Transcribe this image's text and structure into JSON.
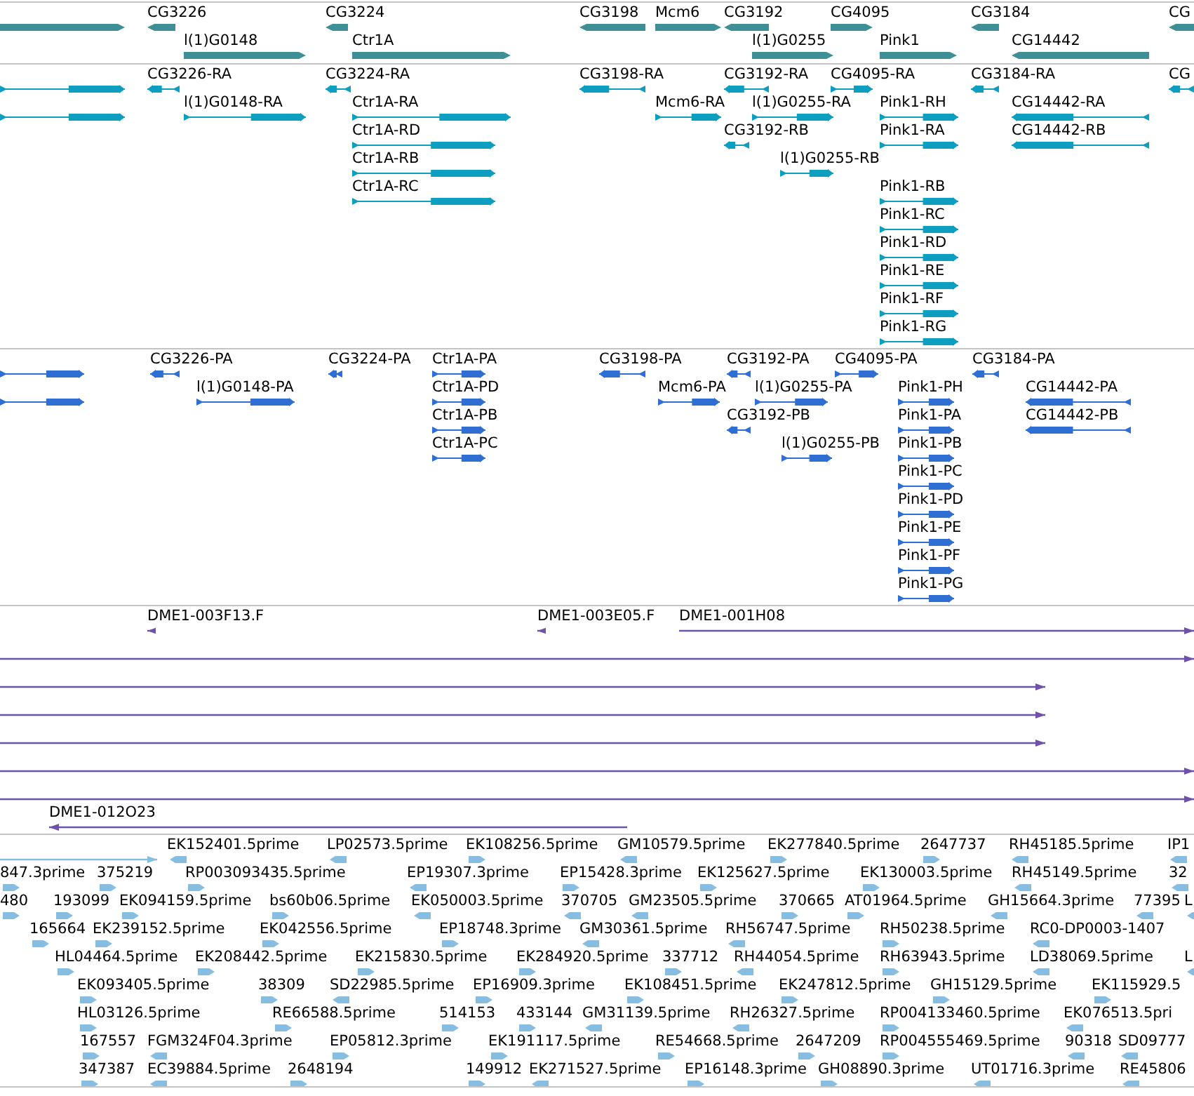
{
  "tracks": [
    {
      "kind": "gene",
      "features": [
        {
          "reverse": false
        },
        {
          "label": "CG3226",
          "reverse": true
        },
        {
          "label": "CG3224",
          "reverse": true
        },
        {
          "label": "CG3198",
          "reverse": true
        },
        {
          "label": "Mcm6",
          "reverse": false
        },
        {
          "label": "CG3192",
          "reverse": true
        },
        {
          "label": "CG4095",
          "reverse": false
        },
        {
          "label": "CG3184",
          "reverse": true
        },
        {
          "label": "CG",
          "reverse": true
        },
        {
          "label": "l(1)G0148",
          "reverse": false
        },
        {
          "label": "Ctr1A",
          "reverse": false
        },
        {
          "label": "l(1)G0255",
          "reverse": false
        },
        {
          "label": "Pink1",
          "reverse": false
        },
        {
          "label": "CG14442",
          "reverse": true
        }
      ]
    },
    {
      "kind": "transcript",
      "features": [
        {
          "reverse": false
        },
        {
          "label": "CG3226-RA",
          "reverse": true
        },
        {
          "label": "CG3224-RA",
          "reverse": true
        },
        {
          "label": "CG3198-RA",
          "reverse": true
        },
        {
          "label": "CG3192-RA",
          "reverse": true
        },
        {
          "label": "CG4095-RA",
          "reverse": false
        },
        {
          "label": "CG3184-RA",
          "reverse": true
        },
        {
          "label": "CG",
          "reverse": true
        },
        {
          "reverse": false
        },
        {
          "label": "l(1)G0148-RA",
          "reverse": false
        },
        {
          "label": "Ctr1A-RA",
          "reverse": false
        },
        {
          "label": "Mcm6-RA",
          "reverse": false
        },
        {
          "label": "l(1)G0255-RA",
          "reverse": false
        },
        {
          "label": "Pink1-RH",
          "reverse": false
        },
        {
          "label": "CG14442-RA",
          "reverse": true
        },
        {
          "label": "Ctr1A-RD",
          "reverse": false
        },
        {
          "label": "CG3192-RB",
          "reverse": true
        },
        {
          "label": "Pink1-RA",
          "reverse": false
        },
        {
          "label": "CG14442-RB",
          "reverse": true
        },
        {
          "label": "Ctr1A-RB",
          "reverse": false
        },
        {
          "label": "l(1)G0255-RB",
          "reverse": false
        },
        {
          "label": "Ctr1A-RC",
          "reverse": false
        },
        {
          "label": "Pink1-RB",
          "reverse": false
        },
        {
          "label": "Pink1-RC",
          "reverse": false
        },
        {
          "label": "Pink1-RD",
          "reverse": false
        },
        {
          "label": "Pink1-RE",
          "reverse": false
        },
        {
          "label": "Pink1-RF",
          "reverse": false
        },
        {
          "label": "Pink1-RG",
          "reverse": false
        }
      ]
    },
    {
      "kind": "protein",
      "features": [
        {
          "reverse": false
        },
        {
          "label": "CG3226-PA",
          "reverse": true
        },
        {
          "label": "CG3224-PA",
          "reverse": true
        },
        {
          "label": "Ctr1A-PA",
          "reverse": false
        },
        {
          "label": "CG3198-PA",
          "reverse": true
        },
        {
          "label": "CG3192-PA",
          "reverse": true
        },
        {
          "label": "CG4095-PA",
          "reverse": false
        },
        {
          "label": "CG3184-PA",
          "reverse": true
        },
        {
          "reverse": false
        },
        {
          "label": "l(1)G0148-PA",
          "reverse": false
        },
        {
          "label": "Ctr1A-PD",
          "reverse": false
        },
        {
          "label": "Mcm6-PA",
          "reverse": false
        },
        {
          "label": "l(1)G0255-PA",
          "reverse": false
        },
        {
          "label": "Pink1-PH",
          "reverse": false
        },
        {
          "label": "CG14442-PA",
          "reverse": true
        },
        {
          "label": "Ctr1A-PB",
          "reverse": false
        },
        {
          "label": "CG3192-PB",
          "reverse": true
        },
        {
          "label": "Pink1-PA",
          "reverse": false
        },
        {
          "label": "CG14442-PB",
          "reverse": true
        },
        {
          "label": "Ctr1A-PC",
          "reverse": false
        },
        {
          "label": "l(1)G0255-PB",
          "reverse": false
        },
        {
          "label": "Pink1-PB",
          "reverse": false
        },
        {
          "label": "Pink1-PC",
          "reverse": false
        },
        {
          "label": "Pink1-PD",
          "reverse": false
        },
        {
          "label": "Pink1-PE",
          "reverse": false
        },
        {
          "label": "Pink1-PF",
          "reverse": false
        },
        {
          "label": "Pink1-PG",
          "reverse": false
        }
      ]
    },
    {
      "kind": "clone",
      "features": [
        {
          "label": "DME1-003F13.F",
          "reverse": true
        },
        {
          "label": "DME1-003E05.F",
          "reverse": true
        },
        {
          "label": "DME1-001H08",
          "reverse": false
        },
        {
          "reverse": false
        },
        {
          "reverse": false
        },
        {
          "reverse": false
        },
        {
          "reverse": false
        },
        {
          "reverse": false
        },
        {
          "reverse": false
        },
        {
          "label": "DME1-012O23",
          "reverse": true
        }
      ]
    },
    {
      "kind": "est",
      "features": [
        {
          "reverse": false
        },
        {
          "label": "EK152401.5prime",
          "reverse": true
        },
        {
          "label": "LP02573.5prime",
          "reverse": true
        },
        {
          "label": "EK108256.5prime",
          "reverse": false
        },
        {
          "label": "GM10579.5prime",
          "reverse": true
        },
        {
          "label": "EK277840.5prime",
          "reverse": false
        },
        {
          "label": "2647737",
          "reverse": false
        },
        {
          "label": "RH45185.5prime",
          "reverse": true
        },
        {
          "label": "IP1",
          "reverse": true
        },
        {
          "label": "847.3prime",
          "reverse": false
        },
        {
          "label": "375219",
          "reverse": false
        },
        {
          "label": "RP003093435.5prime",
          "reverse": false
        },
        {
          "label": "EP19307.3prime",
          "reverse": true
        },
        {
          "label": "EP15428.3prime",
          "reverse": false
        },
        {
          "label": "EK125627.5prime",
          "reverse": false
        },
        {
          "label": "EK130003.5prime",
          "reverse": false
        },
        {
          "label": "RH45149.5prime",
          "reverse": true
        },
        {
          "label": "32",
          "reverse": true
        },
        {
          "label": "480",
          "reverse": false
        },
        {
          "label": "193099",
          "reverse": false
        },
        {
          "label": "EK094159.5prime",
          "reverse": false
        },
        {
          "label": "bs60b06.5prime",
          "reverse": false
        },
        {
          "label": "EK050003.5prime",
          "reverse": true
        },
        {
          "label": "370705",
          "reverse": true
        },
        {
          "label": "GM23505.5prime",
          "reverse": true
        },
        {
          "label": "370665",
          "reverse": false
        },
        {
          "label": "AT01964.5prime",
          "reverse": false
        },
        {
          "label": "GH15664.3prime",
          "reverse": true
        },
        {
          "label": "77395",
          "reverse": true
        },
        {
          "label": "L",
          "reverse": true
        },
        {
          "label": "165664",
          "reverse": false
        },
        {
          "label": "EK239152.5prime",
          "reverse": false
        },
        {
          "label": "EK042556.5prime",
          "reverse": false
        },
        {
          "label": "EP18748.3prime",
          "reverse": false
        },
        {
          "label": "GM30361.5prime",
          "reverse": true
        },
        {
          "label": "RH56747.5prime",
          "reverse": true
        },
        {
          "label": "RH50238.5prime",
          "reverse": false
        },
        {
          "label": "RC0-DP0003-1407",
          "reverse": true
        },
        {
          "label": "HL04464.5prime",
          "reverse": false
        },
        {
          "label": "EK208442.5prime",
          "reverse": false
        },
        {
          "label": "EK215830.5prime",
          "reverse": false
        },
        {
          "label": "EK284920.5prime",
          "reverse": false
        },
        {
          "label": "337712",
          "reverse": false
        },
        {
          "label": "RH44054.5prime",
          "reverse": true
        },
        {
          "label": "RH63943.5prime",
          "reverse": false
        },
        {
          "label": "LD38069.5prime",
          "reverse": true
        },
        {
          "label": "L",
          "reverse": true
        },
        {
          "label": "EK093405.5prime",
          "reverse": false
        },
        {
          "label": "38309",
          "reverse": false
        },
        {
          "label": "SD22985.5prime",
          "reverse": true
        },
        {
          "label": "EP16909.3prime",
          "reverse": false
        },
        {
          "label": "EK108451.5prime",
          "reverse": false
        },
        {
          "label": "EK247812.5prime",
          "reverse": false
        },
        {
          "label": "GH15129.5prime",
          "reverse": false
        },
        {
          "label": "EK115929.5",
          "reverse": false
        },
        {
          "label": "HL03126.5prime",
          "reverse": false
        },
        {
          "label": "RE66588.5prime",
          "reverse": false
        },
        {
          "label": "514153",
          "reverse": false
        },
        {
          "label": "433144",
          "reverse": false
        },
        {
          "label": "GM31139.5prime",
          "reverse": true
        },
        {
          "label": "RH26327.5prime",
          "reverse": true
        },
        {
          "label": "RP004133460.5prime",
          "reverse": false
        },
        {
          "label": "EK076513.5pri",
          "reverse": true
        },
        {
          "label": "167557",
          "reverse": false
        },
        {
          "label": "FGM324F04.3prime",
          "reverse": true
        },
        {
          "label": "EP05812.3prime",
          "reverse": false
        },
        {
          "label": "EK191117.5prime",
          "reverse": false
        },
        {
          "label": "RE54668.5prime",
          "reverse": false
        },
        {
          "label": "2647209",
          "reverse": false
        },
        {
          "label": "RP004555469.5prime",
          "reverse": false
        },
        {
          "label": "90318",
          "reverse": true
        },
        {
          "label": "SD09777",
          "reverse": true
        },
        {
          "label": "347387",
          "reverse": false
        },
        {
          "label": "EC39884.5prime",
          "reverse": true
        },
        {
          "label": "2648194",
          "reverse": false
        },
        {
          "label": "149912",
          "reverse": false
        },
        {
          "label": "EK271527.5prime",
          "reverse": true
        },
        {
          "label": "EP16148.3prime",
          "reverse": false
        },
        {
          "label": "GH08890.3prime",
          "reverse": false
        },
        {
          "label": "UT01716.3prime",
          "reverse": true
        },
        {
          "label": "RE45806",
          "reverse": true
        }
      ]
    }
  ]
}
